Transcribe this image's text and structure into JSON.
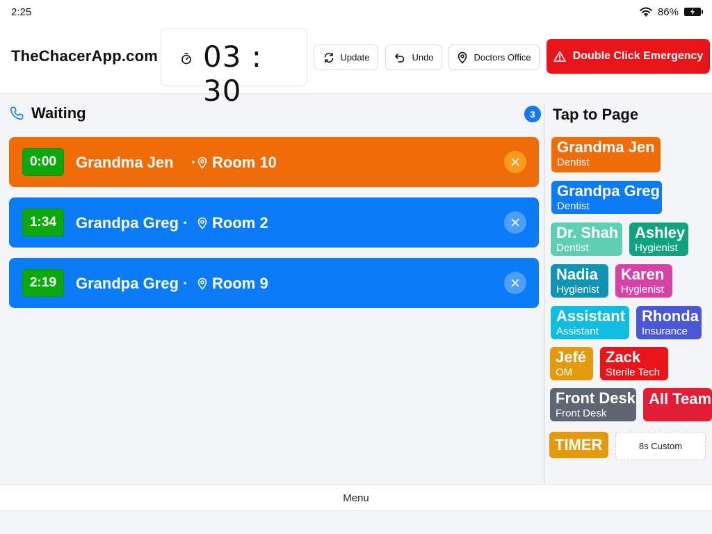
{
  "status_bar": {
    "time": "2:25",
    "battery": "86%"
  },
  "header": {
    "brand": "TheChacerApp.com",
    "timer": "03 : 30",
    "update_label": "Update",
    "undo_label": "Undo",
    "location_label": "Doctors Office",
    "emergency_label": "Double Click Emergency"
  },
  "waiting": {
    "title": "Waiting",
    "count": "3",
    "items": [
      {
        "elapsed": "0:00",
        "name": "Grandma Jen",
        "room": "Room 10",
        "color": "#ef6c09"
      },
      {
        "elapsed": "1:34",
        "name": "Grandpa Greg",
        "room": "Room 2",
        "color": "#0b7bf7"
      },
      {
        "elapsed": "2:19",
        "name": "Grandpa Greg",
        "room": "Room 9",
        "color": "#0b7bf7"
      }
    ]
  },
  "page_panel": {
    "title": "Tap to Page",
    "chips": [
      {
        "name": "Grandma Jen",
        "role": "Dentist",
        "color": "#ef6c09"
      },
      {
        "name": "Grandpa Greg",
        "role": "Dentist",
        "color": "#0b7bf7"
      },
      {
        "name": "Dr. Shah",
        "role": "Dentist",
        "color": "#5ecfb0"
      },
      {
        "name": "Ashley",
        "role": "Hygienist",
        "color": "#10a37f"
      },
      {
        "name": "Nadia",
        "role": "Hygienist",
        "color": "#0f94b6"
      },
      {
        "name": "Karen",
        "role": "Hygienist",
        "color": "#d642a6"
      },
      {
        "name": "Assistant",
        "role": "Assistant",
        "color": "#10bde0"
      },
      {
        "name": "Rhonda",
        "role": "Insurance",
        "color": "#4a57d6"
      },
      {
        "name": "Jefé",
        "role": "OM",
        "color": "#e59a0d"
      },
      {
        "name": "Zack",
        "role": "Sterile Tech",
        "color": "#e8141a"
      },
      {
        "name": "Front Desk",
        "role": "Front Desk",
        "color": "#5f6672"
      },
      {
        "name": "All Team",
        "color": "#e21d35"
      },
      {
        "name": "TIMER",
        "color": "#e59a0d"
      }
    ],
    "custom_label": "8s Custom"
  },
  "menu_label": "Menu"
}
